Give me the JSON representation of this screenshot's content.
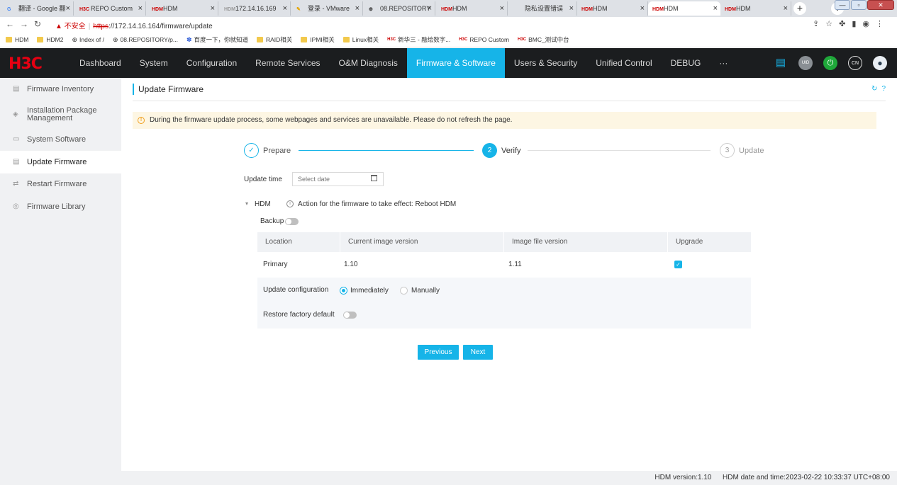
{
  "browser": {
    "tabs": [
      {
        "icon": "G",
        "title": "翻译 - Google 翻"
      },
      {
        "icon": "H3C",
        "title": "REPO Custom"
      },
      {
        "icon": "HDM",
        "title": "HDM"
      },
      {
        "icon": "HDM",
        "title": "172.14.16.169"
      },
      {
        "icon": "✎",
        "title": "登录 - VMware"
      },
      {
        "icon": "⊕",
        "title": "08.REPOSITORY"
      },
      {
        "icon": "HDM",
        "title": "HDM"
      },
      {
        "icon": "",
        "title": "隐私设置错误"
      },
      {
        "icon": "HDM",
        "title": "HDM"
      },
      {
        "icon": "HDM",
        "title": "HDM"
      },
      {
        "icon": "HDM",
        "title": "HDM"
      }
    ],
    "url_warning": "不安全",
    "url_protocol": "https",
    "url_rest": "://172.14.16.164/firmware/update",
    "bookmarks": [
      {
        "type": "folder",
        "label": "HDM"
      },
      {
        "type": "folder",
        "label": "HDM2"
      },
      {
        "type": "globe",
        "label": "Index of /"
      },
      {
        "type": "globe",
        "label": "08.REPOSITORY/p..."
      },
      {
        "type": "paw",
        "label": "百度一下，你就知道"
      },
      {
        "type": "folder",
        "label": "RAID相关"
      },
      {
        "type": "folder",
        "label": "IPMI相关"
      },
      {
        "type": "folder",
        "label": "Linux相关"
      },
      {
        "type": "h3c",
        "label": "新华三 - 融绘数字..."
      },
      {
        "type": "h3c",
        "label": "REPO Custom"
      },
      {
        "type": "h3c",
        "label": "BMC_测试中台"
      }
    ]
  },
  "header": {
    "logo": "H3C",
    "nav": [
      "Dashboard",
      "System",
      "Configuration",
      "Remote Services",
      "O&M Diagnosis",
      "Firmware & Software",
      "Users & Security",
      "Unified Control",
      "DEBUG",
      "···"
    ],
    "active_nav": "Firmware & Software",
    "icons": [
      {
        "name": "clipboard-icon",
        "glyph": "▤",
        "color": "#16b4e8"
      },
      {
        "name": "uid-icon",
        "glyph": "UID",
        "color": "#8a8f94"
      },
      {
        "name": "power-icon",
        "glyph": "⏻",
        "color": "#1fa83a"
      },
      {
        "name": "language-icon",
        "glyph": "CN",
        "color": "#1b1d1f"
      },
      {
        "name": "user-icon",
        "glyph": "●",
        "color": "#e9eef3"
      }
    ]
  },
  "sidebar": {
    "items": [
      {
        "label": "Firmware Inventory",
        "icon": "▤"
      },
      {
        "label": "Installation Package Management",
        "icon": "◈"
      },
      {
        "label": "System Software",
        "icon": "▭"
      },
      {
        "label": "Update Firmware",
        "icon": "▤"
      },
      {
        "label": "Restart Firmware",
        "icon": "⇄"
      },
      {
        "label": "Firmware Library",
        "icon": "◎"
      }
    ],
    "active": "Update Firmware"
  },
  "page": {
    "title": "Update Firmware",
    "notice": "During the firmware update process, some webpages and services are unavailable. Please do not refresh the page.",
    "steps": [
      {
        "index": "1",
        "label": "Prepare",
        "state": "done"
      },
      {
        "index": "2",
        "label": "Verify",
        "state": "current"
      },
      {
        "index": "3",
        "label": "Update",
        "state": "todo"
      }
    ],
    "update_time_label": "Update time",
    "date_placeholder": "Select date",
    "component": "HDM",
    "action_note": "Action for the firmware to take effect: Reboot HDM",
    "backup_label": "Backup",
    "backup_on": false,
    "table": {
      "headers": [
        "Location",
        "Current image version",
        "Image file version",
        "Upgrade"
      ],
      "rows": [
        {
          "location": "Primary",
          "current": "1.10",
          "image": "1.11",
          "upgrade": true
        }
      ]
    },
    "update_config_label": "Update configuration",
    "update_options": [
      "Immediately",
      "Manually"
    ],
    "update_selected": "Immediately",
    "restore_label": "Restore factory default",
    "restore_on": false,
    "buttons": {
      "previous": "Previous",
      "next": "Next"
    }
  },
  "footer": {
    "version": "HDM version:1.10",
    "datetime": "HDM date and time:2023-02-22 10:33:37 UTC+08:00"
  },
  "colors": {
    "accent": "#16b4e8",
    "header_bg": "#1b1d1f",
    "logo": "#e60012",
    "notice_bg": "#fdf6e3",
    "warning": "#f0a020"
  }
}
